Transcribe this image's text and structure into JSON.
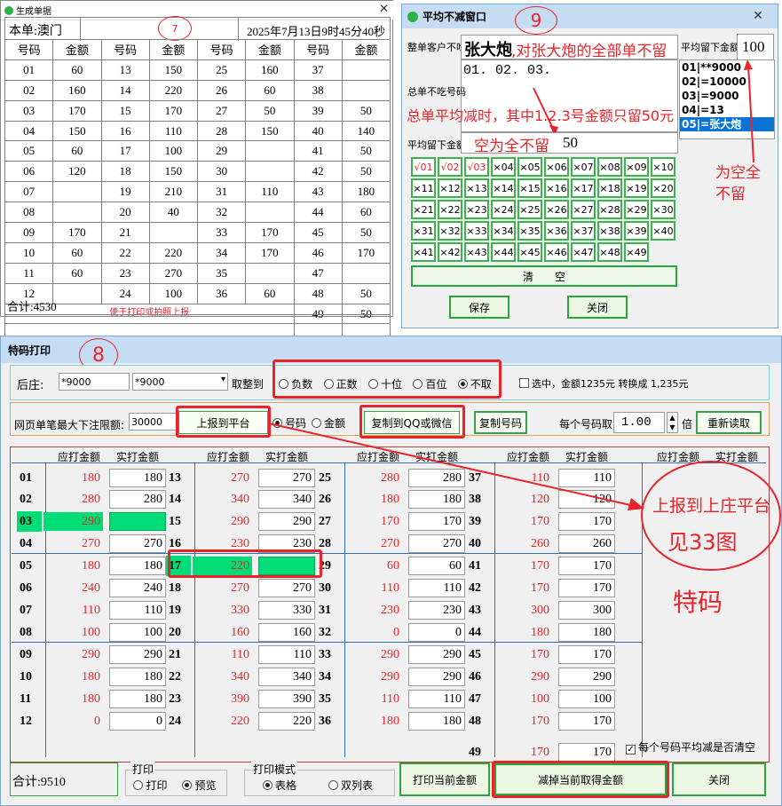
{
  "win1": {
    "title": "生成单据",
    "header_label": "本单:澳门",
    "circle_num": "7",
    "datetime": "2025年7月13日9时45分40秒",
    "col_headers": [
      "号码",
      "金额",
      "号码",
      "金额",
      "号码",
      "金额",
      "号码",
      "金额"
    ],
    "rows": [
      [
        "01",
        "60",
        "13",
        "150",
        "25",
        "160",
        "37",
        ""
      ],
      [
        "02",
        "160",
        "14",
        "220",
        "26",
        "60",
        "38",
        ""
      ],
      [
        "03",
        "170",
        "15",
        "170",
        "27",
        "50",
        "39",
        "50"
      ],
      [
        "04",
        "150",
        "16",
        "110",
        "28",
        "150",
        "40",
        "140"
      ],
      [
        "05",
        "60",
        "17",
        "100",
        "29",
        "",
        "41",
        "50"
      ],
      [
        "06",
        "120",
        "18",
        "150",
        "30",
        "",
        "42",
        "50"
      ],
      [
        "07",
        "",
        "19",
        "210",
        "31",
        "110",
        "43",
        "180"
      ],
      [
        "08",
        "",
        "20",
        "40",
        "32",
        "",
        "44",
        "60"
      ],
      [
        "09",
        "170",
        "21",
        "",
        "33",
        "170",
        "45",
        "50"
      ],
      [
        "10",
        "60",
        "22",
        "220",
        "34",
        "170",
        "46",
        "170"
      ],
      [
        "11",
        "60",
        "23",
        "270",
        "35",
        "",
        "47",
        ""
      ],
      [
        "12",
        "",
        "24",
        "100",
        "36",
        "60",
        "48",
        "50"
      ]
    ],
    "note": "便于打印或拍照上报",
    "row49": [
      "49",
      "50"
    ],
    "total": "合计:4530"
  },
  "win2": {
    "title": "平均不减窗口",
    "circle_num": "9",
    "label_whole": "整单客户不吃",
    "name_value": "张大炮",
    "annot_name": ",对张大炮的全部单不留",
    "label_avg_keep": "平均留下金额",
    "avg_keep_value": "100",
    "list_items": [
      "01|**9000",
      "02|=10000",
      "03|=9000",
      "04|=13",
      "05|=张大炮"
    ],
    "list_selected": 4,
    "list_annot": "为空全不留",
    "codes_value": "01. 02. 03.",
    "label_total_no": "总单不吃号码",
    "annot_mid": "总单平均减时，其中1.2.3号金额只留50元",
    "label_avg_keep2": "平均留下金额",
    "annot_empty": "空为全不留",
    "avg_keep2_value": "50",
    "grid": [
      "√01",
      "√02",
      "√03",
      "×04",
      "×05",
      "×06",
      "×07",
      "×08",
      "×09",
      "×10",
      "×11",
      "×12",
      "×13",
      "×14",
      "×15",
      "×16",
      "×17",
      "×18",
      "×19",
      "×20",
      "×21",
      "×22",
      "×23",
      "×24",
      "×25",
      "×26",
      "×27",
      "×28",
      "×29",
      "×30",
      "×31",
      "×32",
      "×33",
      "×34",
      "×35",
      "×36",
      "×37",
      "×38",
      "×39",
      "×40",
      "×41",
      "×42",
      "×43",
      "×44",
      "×45",
      "×46",
      "×47",
      "×48",
      "×49"
    ],
    "clear_label": "清　　空",
    "save_label": "保存",
    "close_label": "关闭"
  },
  "win3": {
    "title": "特码打印",
    "circle_num": "8",
    "label_house": "后庄:",
    "house_value1": "*9000",
    "house_value2": "*9000",
    "round_label": "取整到",
    "round_options": [
      "负数",
      "正数",
      "十位",
      "百位",
      "不取"
    ],
    "round_selected": 4,
    "selected_check_text": "选中，金额1235元 转换成 1,235元",
    "limit_label": "网页单笔最大下注限额:",
    "limit_value": "30000",
    "report_btn": "上报到平台",
    "mode_options": [
      "号码",
      "金额"
    ],
    "mode_selected": 0,
    "copy_qq_btn": "复制到QQ或微信",
    "copy_num_btn": "复制号码",
    "per_num_label": "每个号码取",
    "per_num_value": "1.00",
    "times_label": "倍",
    "reload_btn": "重新读取",
    "col_head_a": "应打金额",
    "col_head_b": "实打金额",
    "cols": [
      [
        [
          "01",
          "180",
          "180"
        ],
        [
          "02",
          "280",
          "280"
        ],
        [
          "03",
          "290",
          ""
        ],
        [
          "04",
          "270",
          "270"
        ],
        [
          "05",
          "180",
          "180"
        ],
        [
          "06",
          "240",
          "240"
        ],
        [
          "07",
          "110",
          "110"
        ],
        [
          "08",
          "100",
          "100"
        ],
        [
          "09",
          "290",
          "290"
        ],
        [
          "10",
          "180",
          "180"
        ],
        [
          "11",
          "180",
          "180"
        ],
        [
          "12",
          "0",
          "0"
        ]
      ],
      [
        [
          "13",
          "270",
          "270"
        ],
        [
          "14",
          "340",
          "340"
        ],
        [
          "15",
          "290",
          "290"
        ],
        [
          "16",
          "230",
          "230"
        ],
        [
          "17",
          "220",
          ""
        ],
        [
          "18",
          "270",
          "270"
        ],
        [
          "19",
          "330",
          "330"
        ],
        [
          "20",
          "160",
          "160"
        ],
        [
          "21",
          "110",
          "110"
        ],
        [
          "22",
          "340",
          "340"
        ],
        [
          "23",
          "390",
          "390"
        ],
        [
          "24",
          "220",
          "220"
        ]
      ],
      [
        [
          "25",
          "280",
          "280"
        ],
        [
          "26",
          "180",
          "180"
        ],
        [
          "27",
          "170",
          "170"
        ],
        [
          "28",
          "270",
          "270"
        ],
        [
          "29",
          "60",
          "60"
        ],
        [
          "30",
          "110",
          "110"
        ],
        [
          "31",
          "230",
          "230"
        ],
        [
          "32",
          "0",
          "0"
        ],
        [
          "33",
          "290",
          "290"
        ],
        [
          "34",
          "290",
          "290"
        ],
        [
          "35",
          "110",
          "110"
        ],
        [
          "36",
          "180",
          "180"
        ]
      ],
      [
        [
          "37",
          "110",
          "110"
        ],
        [
          "38",
          "120",
          "120"
        ],
        [
          "39",
          "170",
          "170"
        ],
        [
          "40",
          "260",
          "260"
        ],
        [
          "41",
          "170",
          "170"
        ],
        [
          "42",
          "170",
          "170"
        ],
        [
          "43",
          "300",
          "300"
        ],
        [
          "44",
          "180",
          "180"
        ],
        [
          "45",
          "170",
          "170"
        ],
        [
          "46",
          "290",
          "290"
        ],
        [
          "47",
          "100",
          "100"
        ],
        [
          "48",
          "170",
          "170"
        ],
        [
          "49",
          "170",
          "170"
        ]
      ]
    ],
    "annot_report": "上报到上庄平台",
    "annot_see": "见33图",
    "annot_special": "特码",
    "avg_clear_label": "每个号码平均减是否清空",
    "total": "合计:9510",
    "print_group": "打印",
    "print_options": [
      "打印",
      "预览"
    ],
    "print_selected": 1,
    "print_mode_group": "打印模式",
    "print_mode_options": [
      "表格",
      "双列表"
    ],
    "print_mode_selected": 0,
    "print_current_btn": "打印当前金额",
    "subtract_btn": "减掉当前取得金额",
    "close_btn": "关闭"
  },
  "colors": {
    "accent_red": "#e8242a",
    "green": "#27a83a",
    "highlight_green": "#00dd77",
    "title_blue": "#c6dcf3",
    "select_blue": "#0a74d6"
  }
}
